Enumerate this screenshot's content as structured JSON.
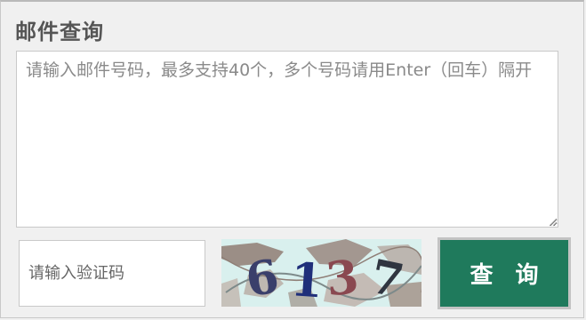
{
  "form": {
    "title": "邮件查询",
    "tracking_numbers": {
      "value": "",
      "placeholder": "请输入邮件号码，最多支持40个，多个号码请用Enter（回车）隔开"
    },
    "captcha_input": {
      "value": "",
      "placeholder": "请输入验证码"
    },
    "captcha_image": {
      "text": "6137"
    },
    "submit_label": "查 询"
  },
  "colors": {
    "submit_bg": "#1f7a5c",
    "submit_text": "#ffffff",
    "title": "#555555"
  },
  "icons": {
    "resize": "resize-grip-icon"
  }
}
